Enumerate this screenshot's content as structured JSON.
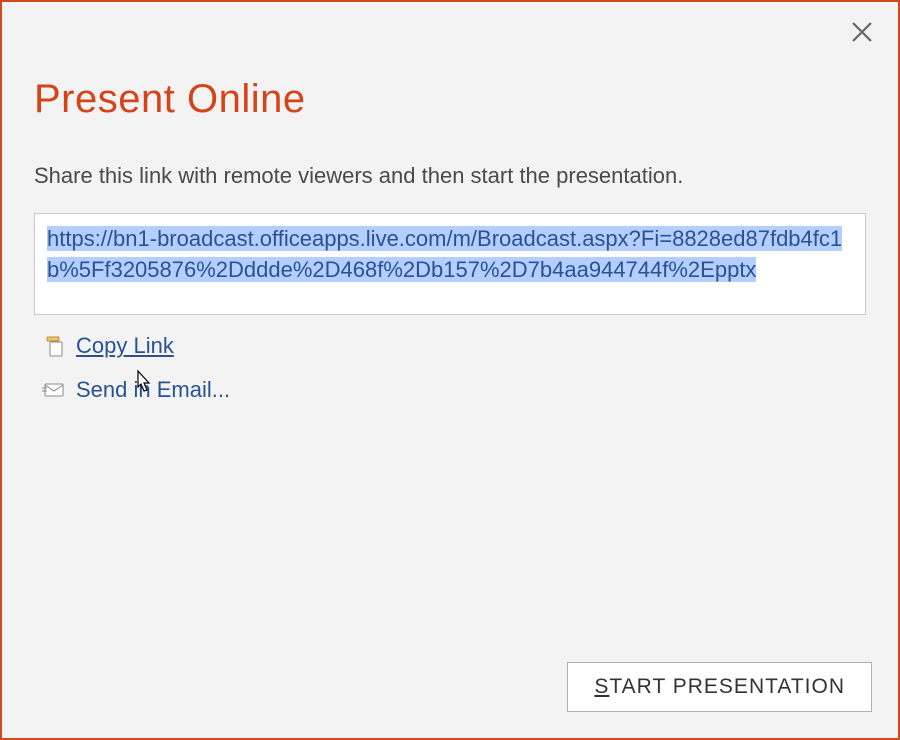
{
  "dialog": {
    "title": "Present Online",
    "instruction": "Share this link with remote viewers and then start the presentation.",
    "share_url": "https://bn1-broadcast.officeapps.live.com/m/Broadcast.aspx?Fi=8828ed87fdb4fc1b%5Ff3205876%2Dddde%2D468f%2Db157%2D7b4aa944744f%2Epptx"
  },
  "actions": {
    "copy_link_label": "Copy Link",
    "send_email_label": "Send in Email..."
  },
  "buttons": {
    "start_presentation_rest": "TART PRESENTATION"
  },
  "icons": {
    "close": "close-icon",
    "clipboard": "clipboard-icon",
    "email": "email-icon"
  },
  "colors": {
    "accent": "#d54319",
    "link": "#2a5293",
    "highlight": "#b3ceff",
    "border": "#d24a1b"
  }
}
